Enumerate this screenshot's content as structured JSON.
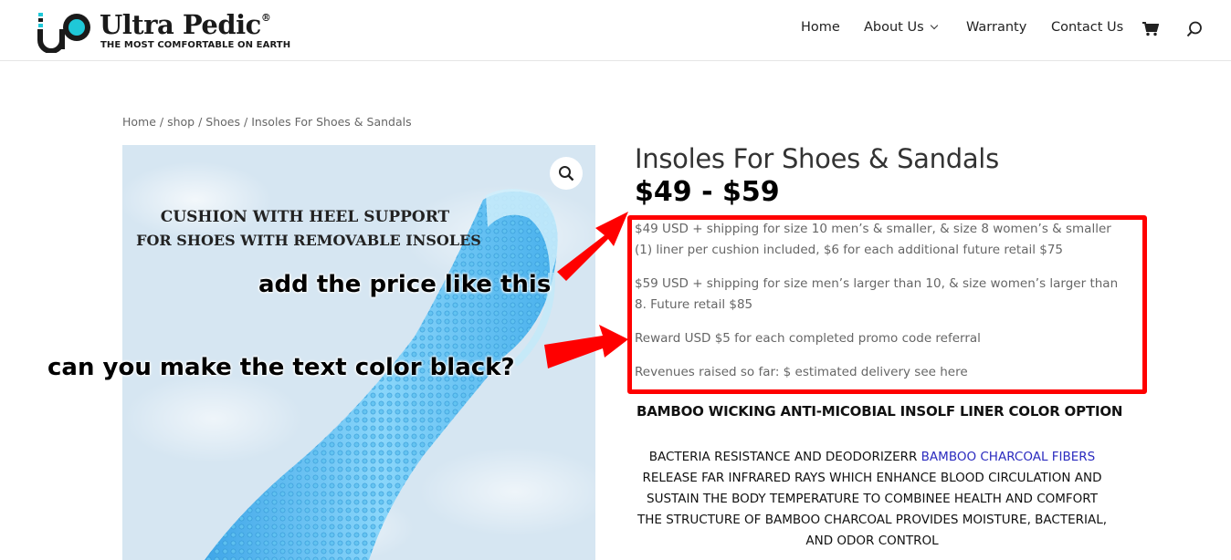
{
  "brand": {
    "name": "Ultra Pedic",
    "trademark": "®",
    "tagline": "THE MOST COMFORTABLE ON EARTH",
    "colors": {
      "accent": "#1fc8d8",
      "dark": "#1a1a1a"
    }
  },
  "nav": {
    "items": [
      {
        "label": "Home"
      },
      {
        "label": "About Us"
      },
      {
        "label": "Warranty"
      },
      {
        "label": "Contact Us"
      }
    ],
    "cart_icon": "cart-icon",
    "search_icon": "search-icon"
  },
  "breadcrumb": {
    "home": "Home",
    "shop": "shop",
    "category": "Shoes",
    "current": "Insoles For Shoes & Sandals",
    "separator": " / "
  },
  "product": {
    "image": {
      "caption_line1": "CUSHION WITH HEEL SUPPORT",
      "caption_line2": "FOR SHOES WITH REMOVABLE INSOLES",
      "zoom_icon": "magnifier-icon"
    },
    "title": "Insoles For Shoes & Sandals",
    "price": "$49 - $59",
    "description": [
      "$49 USD + shipping for size 10 men’s & smaller, & size 8 women’s & smaller (1) liner per cushion included, $6 for each additional future retail $75",
      "$59 USD + shipping for size men’s larger than 10, & size women’s larger than 8. Future retail $85",
      "Reward USD $5 for each completed promo code referral",
      "Revenues raised so far: $ estimated delivery see here"
    ],
    "option_heading": "BAMBOO WICKING ANTI-MICOBIAL INSOLF LINER COLOR OPTION",
    "features": {
      "line1_prefix": "BACTERIA RESISTANCE AND DEODORIZERR ",
      "line1_link": "BAMBOO CHARCOAL FIBERS",
      "line2": "RELEASE FAR INFRARED RAYS WHICH ENHANCE BLOOD CIRCULATION AND",
      "line3": "SUSTAIN THE BODY TEMPERATURE TO COMBINEE HEALTH AND COMFORT",
      "line4": "THE STRUCTURE OF BAMBOO CHARCOAL PROVIDES MOISTURE, BACTERIAL,",
      "line5": "AND ODOR CONTROL"
    }
  },
  "annotations": {
    "note1": "add the price like this",
    "note2": "can you make the text color black?",
    "highlight_color": "#ff0000"
  }
}
